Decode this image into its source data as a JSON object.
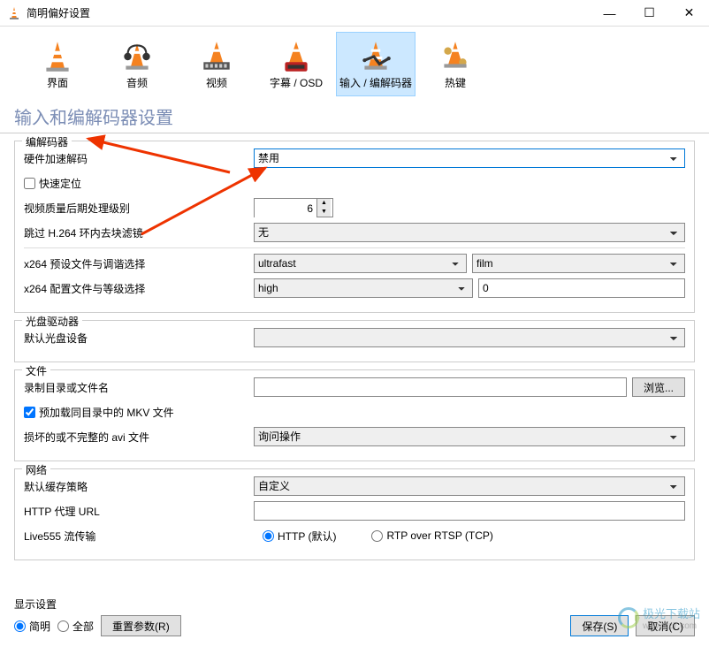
{
  "window": {
    "title": "简明偏好设置"
  },
  "tabs": [
    {
      "label": "界面"
    },
    {
      "label": "音频"
    },
    {
      "label": "视频"
    },
    {
      "label": "字幕 / OSD"
    },
    {
      "label": "输入 / 编解码器"
    },
    {
      "label": "热键"
    }
  ],
  "section_title": "输入和编解码器设置",
  "codec": {
    "legend": "编解码器",
    "hw_accel_label": "硬件加速解码",
    "hw_accel_value": "禁用",
    "fast_seek_label": "快速定位",
    "post_quality_label": "视频质量后期处理级别",
    "post_quality_value": "6",
    "skip_loop_label": "跳过 H.264 环内去块滤镜",
    "skip_loop_value": "无",
    "x264_preset_label": "x264 预设文件与调谐选择",
    "x264_preset_value": "ultrafast",
    "x264_tune_value": "film",
    "x264_profile_label": "x264 配置文件与等级选择",
    "x264_profile_value": "high",
    "x264_level_value": "0"
  },
  "optical": {
    "legend": "光盘驱动器",
    "default_device_label": "默认光盘设备",
    "default_device_value": ""
  },
  "files": {
    "legend": "文件",
    "record_dir_label": "录制目录或文件名",
    "browse_btn": "浏览...",
    "preload_mkv_label": "预加载同目录中的 MKV 文件",
    "damaged_avi_label": "损坏的或不完整的 avi 文件",
    "damaged_avi_value": "询问操作"
  },
  "network": {
    "legend": "网络",
    "cache_label": "默认缓存策略",
    "cache_value": "自定义",
    "proxy_label": "HTTP 代理 URL",
    "proxy_value": "",
    "live555_label": "Live555 流传输",
    "live555_http": "HTTP (默认)",
    "live555_rtp": "RTP over RTSP (TCP)"
  },
  "bottom": {
    "display_label": "显示设置",
    "simple": "简明",
    "all": "全部",
    "reset": "重置参数(R)",
    "save": "保存(S)",
    "cancel": "取消(C)"
  },
  "watermark": {
    "name": "极光下载站",
    "url": "www.xz7.com"
  }
}
